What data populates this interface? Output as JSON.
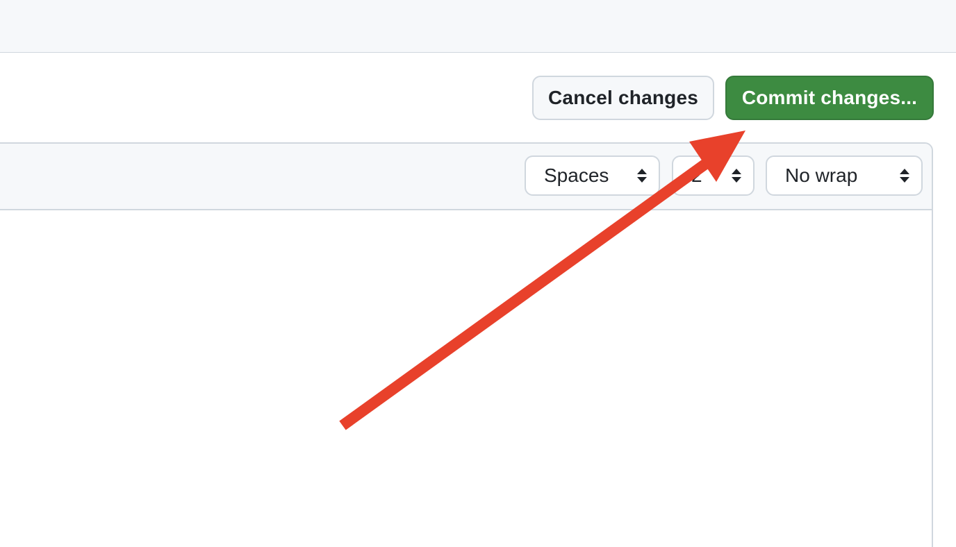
{
  "actions": {
    "cancel_label": "Cancel changes",
    "commit_label": "Commit changes..."
  },
  "editor": {
    "indent_mode": "Spaces",
    "indent_size": "2",
    "wrap_mode": "No wrap"
  },
  "colors": {
    "commit_button": "#3d8b41",
    "annotation_arrow": "#e8412b"
  }
}
